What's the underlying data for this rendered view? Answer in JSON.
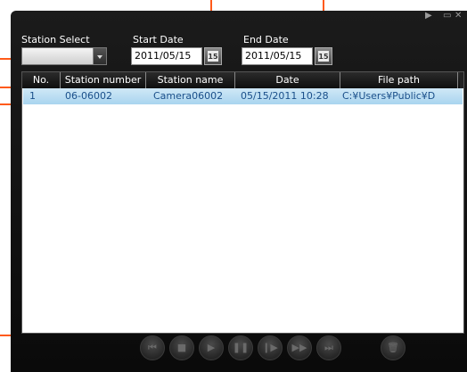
{
  "window": {
    "title_controls": {
      "play": "▶",
      "minimize": "▭",
      "close": "✕"
    }
  },
  "filters": {
    "station_select_label": "Station Select",
    "station_select_value": "",
    "start_date_label": "Start Date",
    "start_date_value": "2011/05/15",
    "end_date_label": "End Date",
    "end_date_value": "2011/05/15",
    "calendar_icon_text": "15"
  },
  "table": {
    "columns": [
      "No.",
      "Station number",
      "Station name",
      "Date",
      "File path"
    ],
    "rows": [
      [
        "1",
        "06-06002",
        "Camera06002",
        "05/15/2011 10:28",
        "C:¥Users¥Public¥D"
      ]
    ]
  },
  "playback": {
    "icons": [
      "skip-back-icon",
      "stop-icon",
      "play-icon",
      "pause-icon",
      "step-forward-icon",
      "fast-forward-icon",
      "skip-end-icon",
      "trash-icon"
    ],
    "glyphs": [
      "⏮",
      "■",
      "▶",
      "❚❚",
      "❙▶",
      "▶▶",
      "⏭",
      "🗑"
    ]
  },
  "colors": {
    "accent_leader": "#ff5a1a",
    "selected_row": "#bfe0f4",
    "selected_text": "#1a4f8a"
  }
}
